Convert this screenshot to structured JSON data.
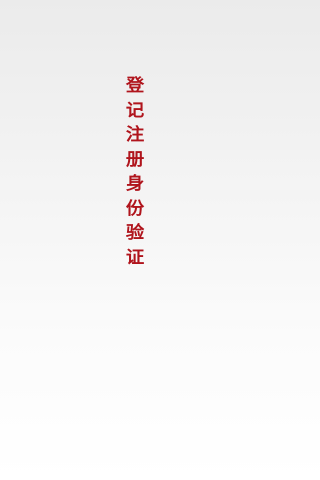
{
  "splash": {
    "title_chars": [
      "登",
      "记",
      "注",
      "册",
      "身",
      "份",
      "验",
      "证"
    ],
    "title_color": "#b0141c"
  }
}
